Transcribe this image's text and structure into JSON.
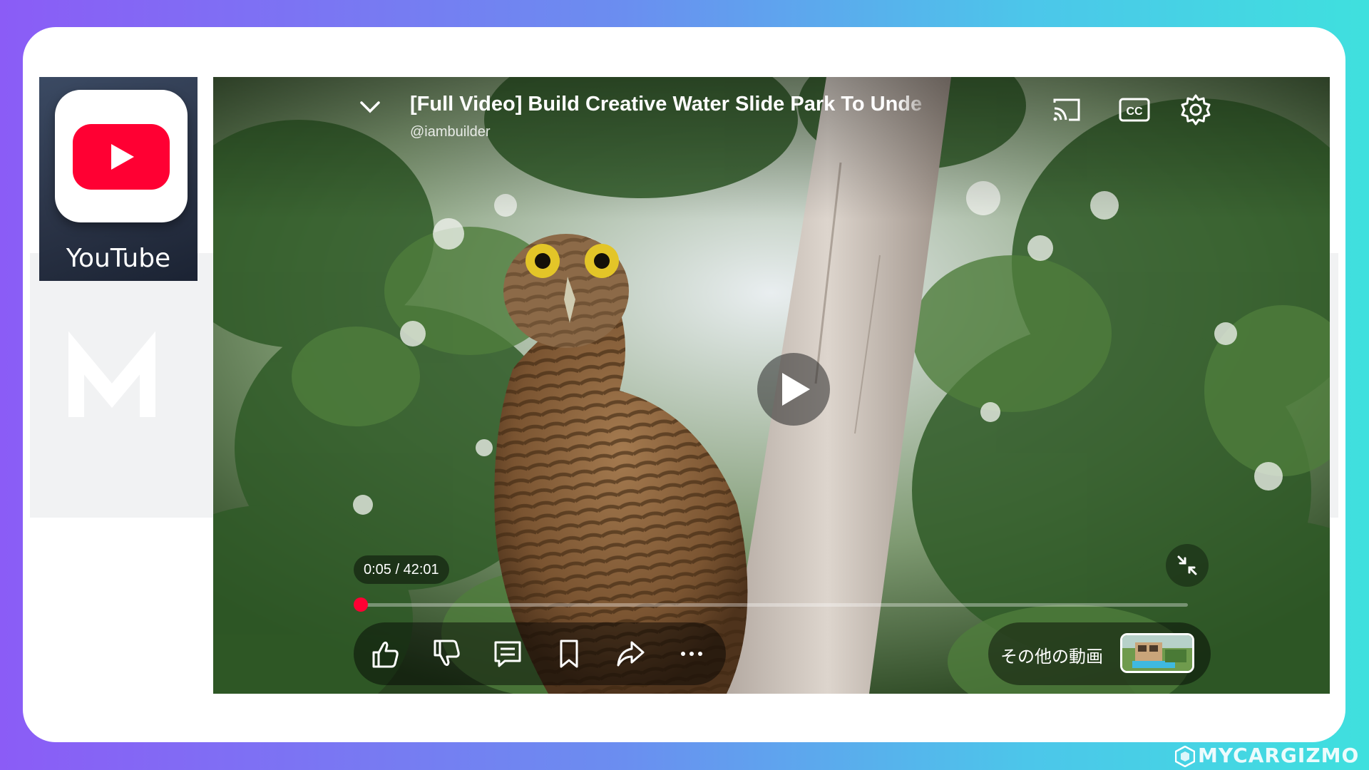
{
  "app_tile": {
    "label": "YouTube",
    "icon": "youtube-icon",
    "brand_color": "#ff0033"
  },
  "player": {
    "title": "[Full Video] Build Creative Water Slide Park To Unde",
    "channel": "@iambuilder",
    "time": "0:05 / 42:01",
    "progress": 0.002,
    "icons": {
      "collapse": "chevron-down-icon",
      "cast": "cast-icon",
      "captions": "cc-icon",
      "settings": "gear-icon",
      "play": "play-icon",
      "minimize": "minimize-icon"
    },
    "actions": [
      {
        "icon": "thumbs-up-icon"
      },
      {
        "icon": "thumbs-down-icon"
      },
      {
        "icon": "comment-icon"
      },
      {
        "icon": "bookmark-icon"
      },
      {
        "icon": "share-icon"
      },
      {
        "icon": "more-icon"
      }
    ],
    "more_videos_label": "その他の動画"
  },
  "watermark": {
    "text": "MYCARGIZMO"
  }
}
